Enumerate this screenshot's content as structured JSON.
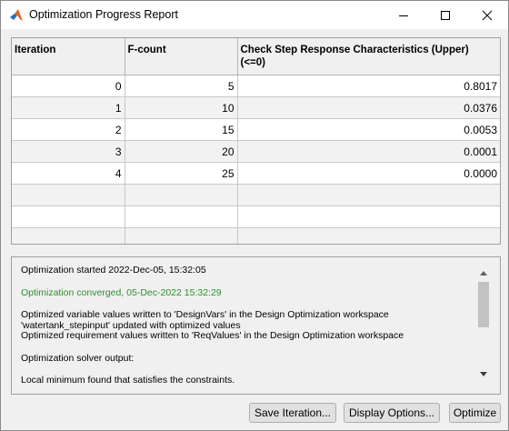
{
  "window": {
    "title": "Optimization Progress Report",
    "icon": "matlab-logo-icon"
  },
  "table": {
    "headers": [
      "Iteration",
      "F-count",
      "Check Step Response Characteristics (Upper)\n(<=0)"
    ],
    "rows": [
      [
        "0",
        "5",
        "0.8017"
      ],
      [
        "1",
        "10",
        "0.0376"
      ],
      [
        "2",
        "15",
        "0.0053"
      ],
      [
        "3",
        "20",
        "0.0001"
      ],
      [
        "4",
        "25",
        "0.0000"
      ]
    ],
    "empty_rows": 3
  },
  "log": {
    "started": "Optimization started 2022-Dec-05, 15:32:05",
    "converged": "Optimization converged, 05-Dec-2022 15:32:29",
    "vars_written": "Optimized variable values written to 'DesignVars' in the Design Optimization workspace",
    "model_updated": "'watertank_stepinput' updated with optimized values",
    "req_written": "Optimized requirement values written to 'ReqValues' in the Design Optimization workspace",
    "solver_output": "Optimization solver output:",
    "local_min": "Local minimum found that satisfies the constraints."
  },
  "buttons": {
    "save": "Save Iteration...",
    "display": "Display Options...",
    "optimize": "Optimize"
  },
  "colors": {
    "converged_text": "#2d8f2d",
    "row_alt": "#f2f2f2"
  }
}
